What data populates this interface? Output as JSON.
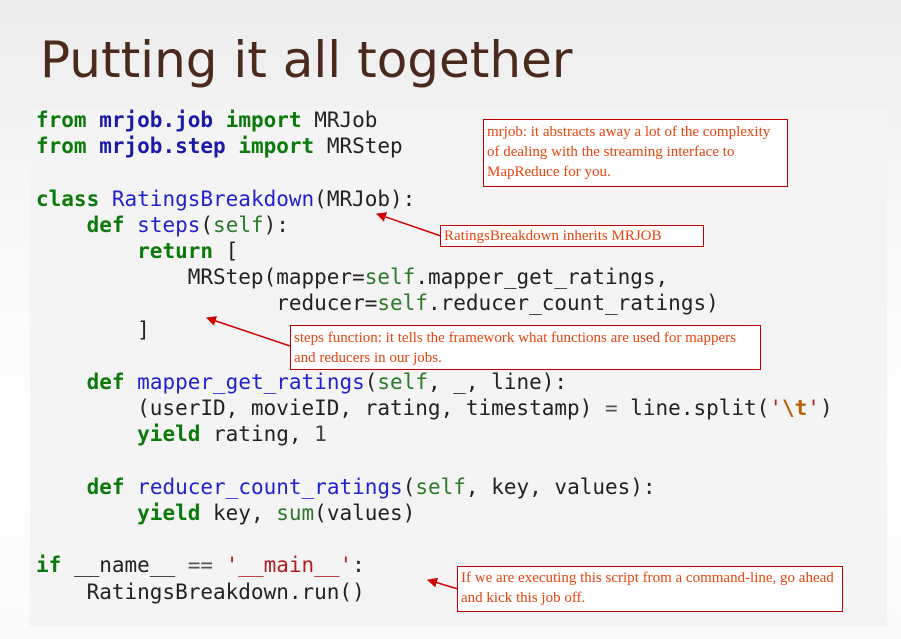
{
  "slide": {
    "title": "Putting it all together"
  },
  "code": {
    "lines": [
      [
        {
          "t": "from",
          "c": "kw"
        },
        {
          "t": " "
        },
        {
          "t": "mrjob.job",
          "c": "mod"
        },
        {
          "t": " "
        },
        {
          "t": "import",
          "c": "kw"
        },
        {
          "t": " MRJob"
        }
      ],
      [
        {
          "t": "from",
          "c": "kw"
        },
        {
          "t": " "
        },
        {
          "t": "mrjob.step",
          "c": "mod"
        },
        {
          "t": " "
        },
        {
          "t": "import",
          "c": "kw"
        },
        {
          "t": " MRStep"
        }
      ],
      [],
      [
        {
          "t": "class",
          "c": "kw"
        },
        {
          "t": " "
        },
        {
          "t": "RatingsBreakdown",
          "c": "fn"
        },
        {
          "t": "(MRJob):"
        }
      ],
      [
        {
          "t": "    "
        },
        {
          "t": "def",
          "c": "kw"
        },
        {
          "t": " "
        },
        {
          "t": "steps",
          "c": "fn"
        },
        {
          "t": "("
        },
        {
          "t": "self",
          "c": "slf"
        },
        {
          "t": "):"
        }
      ],
      [
        {
          "t": "        "
        },
        {
          "t": "return",
          "c": "kw"
        },
        {
          "t": " ["
        }
      ],
      [
        {
          "t": "            MRStep(mapper="
        },
        {
          "t": "self",
          "c": "slf"
        },
        {
          "t": ".mapper_get_ratings,"
        }
      ],
      [
        {
          "t": "                   reducer="
        },
        {
          "t": "self",
          "c": "slf"
        },
        {
          "t": ".reducer_count_ratings)"
        }
      ],
      [
        {
          "t": "        ]"
        }
      ],
      [],
      [
        {
          "t": "    "
        },
        {
          "t": "def",
          "c": "kw"
        },
        {
          "t": " "
        },
        {
          "t": "mapper_get_ratings",
          "c": "fn"
        },
        {
          "t": "("
        },
        {
          "t": "self",
          "c": "slf"
        },
        {
          "t": ", _, line):"
        }
      ],
      [
        {
          "t": "        (userID, movieID, rating, timestamp) "
        },
        {
          "t": "=",
          "c": "op"
        },
        {
          "t": " line.split("
        },
        {
          "t": "'",
          "c": "str"
        },
        {
          "t": "\\t",
          "c": "esc"
        },
        {
          "t": "'",
          "c": "str"
        },
        {
          "t": ")"
        }
      ],
      [
        {
          "t": "        "
        },
        {
          "t": "yield",
          "c": "kw"
        },
        {
          "t": " rating, "
        },
        {
          "t": "1",
          "c": "num"
        }
      ],
      [],
      [
        {
          "t": "    "
        },
        {
          "t": "def",
          "c": "kw"
        },
        {
          "t": " "
        },
        {
          "t": "reducer_count_ratings",
          "c": "fn"
        },
        {
          "t": "("
        },
        {
          "t": "self",
          "c": "slf"
        },
        {
          "t": ", key, values):"
        }
      ],
      [
        {
          "t": "        "
        },
        {
          "t": "yield",
          "c": "kw"
        },
        {
          "t": " key, "
        },
        {
          "t": "sum",
          "c": "slf"
        },
        {
          "t": "(values)"
        }
      ],
      [],
      [
        {
          "t": "if",
          "c": "kw"
        },
        {
          "t": " __name__ "
        },
        {
          "t": "==",
          "c": "op"
        },
        {
          "t": " "
        },
        {
          "t": "'__main__'",
          "c": "str"
        },
        {
          "t": ":"
        }
      ],
      [
        {
          "t": "    RatingsBreakdown.run()"
        }
      ]
    ]
  },
  "annotations": {
    "mrjob": "mrjob: it abstracts away a lot of the complexity of dealing with the streaming interface to MapReduce for you.",
    "inherit": "RatingsBreakdown inherits MRJOB",
    "steps": "steps function: it tells the framework what functions are used for mappers and reducers in our jobs.",
    "main": "If we are executing this script from a command-line, go ahead and kick this job off."
  },
  "colors": {
    "title": "#4a2a1c",
    "annotation_text": "#e84510",
    "annotation_border": "#c00000",
    "keyword": "#0b7a0b",
    "module": "#1a1aa8",
    "function_name": "#2222cc",
    "string": "#b02020"
  }
}
